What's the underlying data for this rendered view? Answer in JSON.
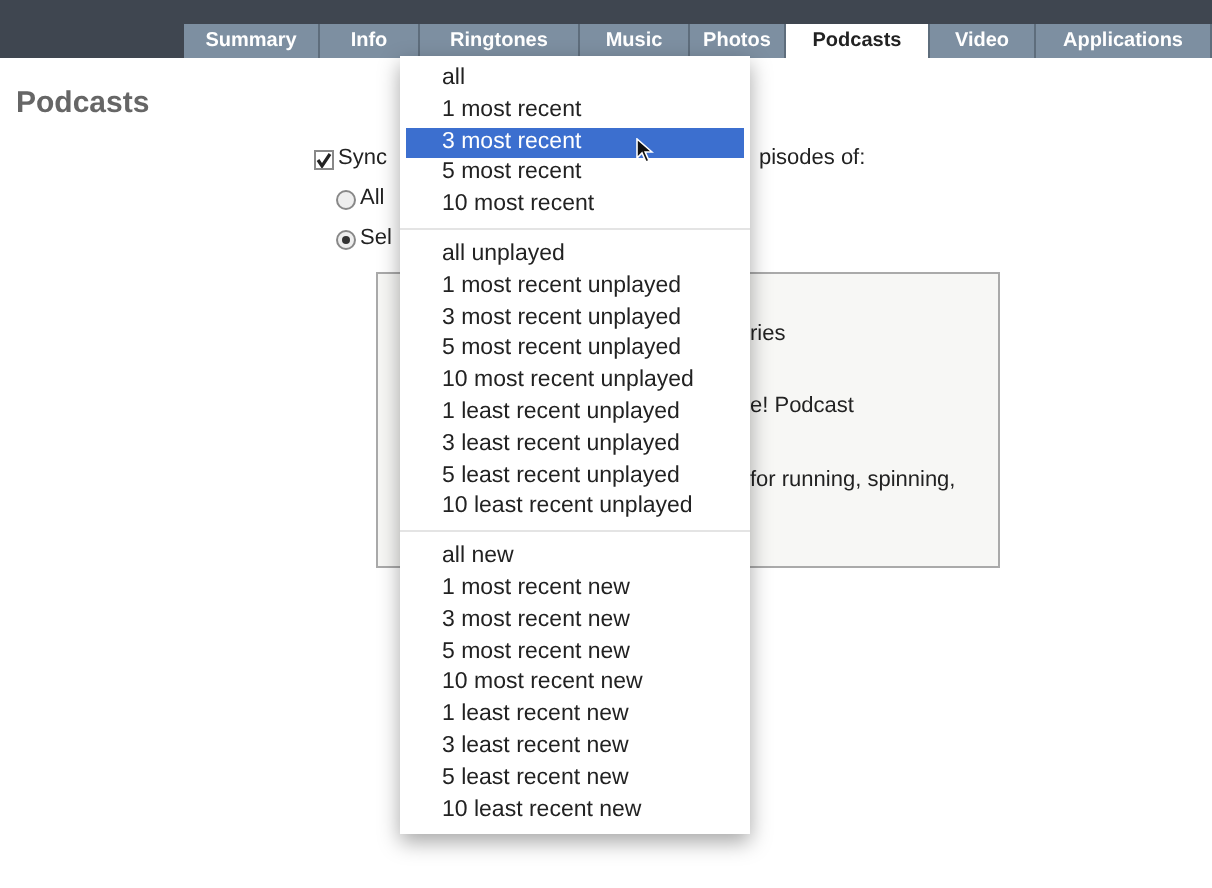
{
  "tabs": [
    {
      "label": "Summary",
      "selected": false
    },
    {
      "label": "Info",
      "selected": false
    },
    {
      "label": "Ringtones",
      "selected": false
    },
    {
      "label": "Music",
      "selected": false
    },
    {
      "label": "Photos",
      "selected": false
    },
    {
      "label": "Podcasts",
      "selected": true
    },
    {
      "label": "Video",
      "selected": false
    },
    {
      "label": "Applications",
      "selected": false
    }
  ],
  "heading": "Podcasts",
  "sync": {
    "label": "Sync",
    "checked": true,
    "trailing": "pisodes of:"
  },
  "radios": [
    {
      "label": "All",
      "selected": false
    },
    {
      "label": "Sel",
      "selected": true
    }
  ],
  "list_fragments": [
    "ries",
    "e! Podcast",
    "for running, spinning,"
  ],
  "menu": {
    "groups": [
      [
        {
          "label": "all",
          "selected": false
        },
        {
          "label": "1 most recent",
          "selected": false
        },
        {
          "label": "3 most recent",
          "selected": true
        },
        {
          "label": "5 most recent",
          "selected": false
        },
        {
          "label": "10 most recent",
          "selected": false
        }
      ],
      [
        {
          "label": "all unplayed",
          "selected": false
        },
        {
          "label": "1 most recent unplayed",
          "selected": false
        },
        {
          "label": "3 most recent unplayed",
          "selected": false
        },
        {
          "label": "5 most recent unplayed",
          "selected": false
        },
        {
          "label": "10 most recent unplayed",
          "selected": false
        },
        {
          "label": "1 least recent unplayed",
          "selected": false
        },
        {
          "label": "3 least recent unplayed",
          "selected": false
        },
        {
          "label": "5 least recent unplayed",
          "selected": false
        },
        {
          "label": "10 least recent unplayed",
          "selected": false
        }
      ],
      [
        {
          "label": "all new",
          "selected": false
        },
        {
          "label": "1 most recent new",
          "selected": false
        },
        {
          "label": "3 most recent new",
          "selected": false
        },
        {
          "label": "5 most recent new",
          "selected": false
        },
        {
          "label": "10 most recent new",
          "selected": false
        },
        {
          "label": "1 least recent new",
          "selected": false
        },
        {
          "label": "3 least recent new",
          "selected": false
        },
        {
          "label": "5 least recent new",
          "selected": false
        },
        {
          "label": "10 least recent new",
          "selected": false
        }
      ]
    ]
  }
}
